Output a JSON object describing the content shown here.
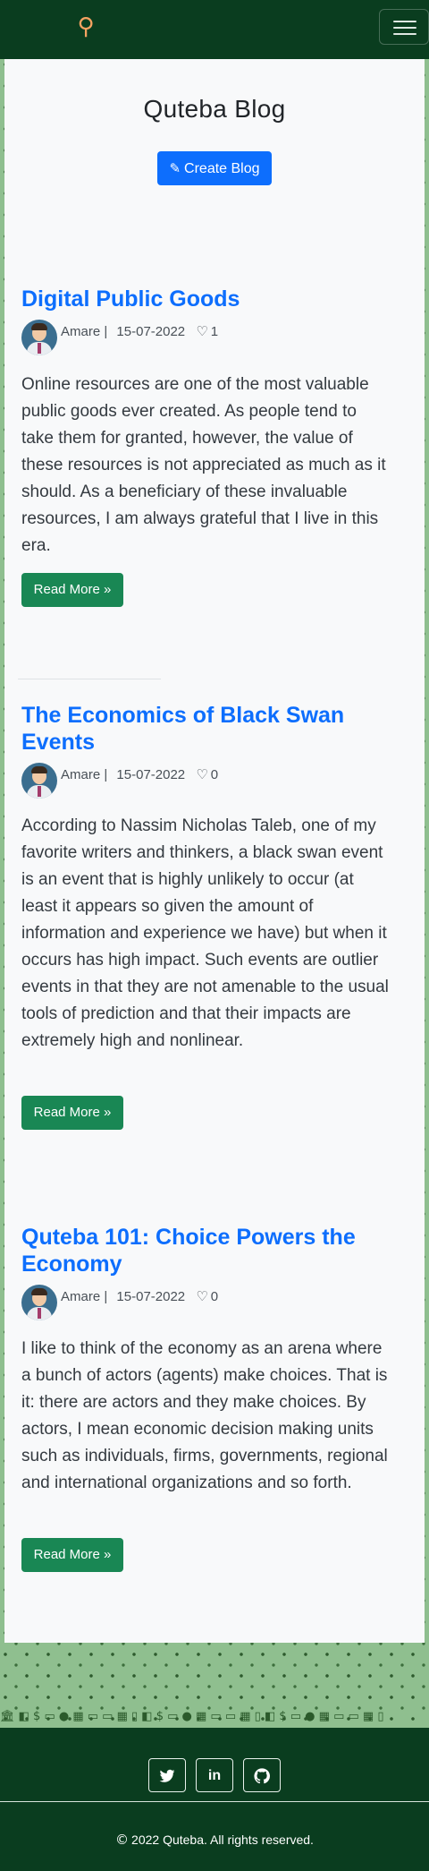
{
  "navbar": {
    "logo_icon": "bike-logo-icon",
    "menu_icon": "hamburger-menu-icon"
  },
  "page": {
    "title": "Quteba Blog",
    "create_label": "Create Blog"
  },
  "posts": [
    {
      "title": "Digital Public Goods",
      "author": "Amare |",
      "date": "15-07-2022",
      "likes": "1",
      "excerpt": "Online resources are one of the most valuable public goods ever created. As people tend to take them for granted, however, the value of these resources is not appreciated as much as it should. As a beneficiary of these invaluable resources, I am always grateful that I live in this era.",
      "read_more": "Read More »"
    },
    {
      "title": "The Economics of Black Swan Events",
      "author": "Amare |",
      "date": "15-07-2022",
      "likes": "0",
      "excerpt": "According to Nassim Nicholas Taleb, one of my favorite writers and thinkers, a black swan event is an event that is highly unlikely to occur (at least it appears so given the amount of information and experience we have) but when it occurs has high impact. Such events are outlier events in that they are not amenable to the usual tools of prediction and that their impacts are extremely high and nonlinear.",
      "read_more": "Read More »"
    },
    {
      "title": "Quteba 101: Choice Powers the Economy",
      "author": "Amare |",
      "date": "15-07-2022",
      "likes": "0",
      "excerpt": "I like to think of the economy as an arena where a bunch of actors (agents) make choices. That is it: there are actors and they make choices. By actors, I mean economic decision making units such as individuals, firms, governments, regional and international organizations and so forth.",
      "read_more": "Read More »"
    }
  ],
  "footer": {
    "social": [
      {
        "icon": "twitter-icon",
        "glyph": "🐦"
      },
      {
        "icon": "linkedin-icon",
        "glyph": "in"
      },
      {
        "icon": "github-icon",
        "glyph": "◉"
      }
    ],
    "copyright": "2022 Quteba. All rights reserved."
  },
  "colors": {
    "navbar": "#0a3d1f",
    "link": "#0d6efd",
    "read_more": "#198754",
    "background_pattern": "#8fbf8f"
  }
}
